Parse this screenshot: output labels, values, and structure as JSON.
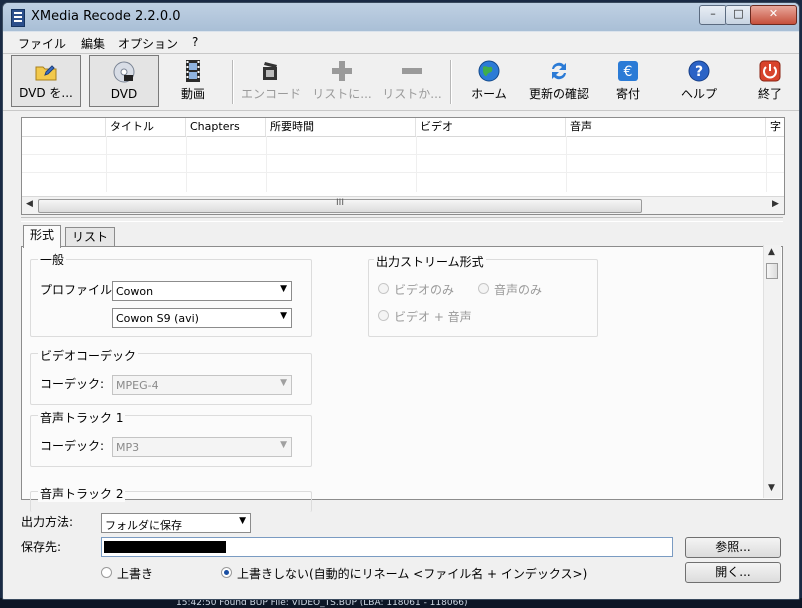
{
  "window": {
    "title": "XMedia Recode 2.2.0.0"
  },
  "menu": [
    "ファイル",
    "編集",
    "オプション",
    "?"
  ],
  "toolbar": {
    "open_dvd": "DVD を...",
    "dvd": "DVD",
    "video": "動画",
    "encode": "エンコード",
    "add_to_list": "リストに...",
    "remove_from_list": "リストか...",
    "home": "ホーム",
    "check_update": "更新の確認",
    "donate": "寄付",
    "help": "ヘルプ",
    "exit": "終了"
  },
  "list": {
    "columns": [
      "",
      "タイトル",
      "Chapters",
      "所要時間",
      "ビデオ",
      "音声",
      "字"
    ],
    "rows": [],
    "scroll_grip": "III"
  },
  "tabs": {
    "format": "形式",
    "list": "リスト"
  },
  "general": {
    "title": "一般",
    "profile_label": "プロファイル:",
    "profile_value": "Cowon",
    "device_value": "Cowon S9 (avi)"
  },
  "video_codec": {
    "title": "ビデオコーデック",
    "codec_label": "コーデック:",
    "codec_value": "MPEG-4"
  },
  "audio_track1": {
    "title": "音声トラック 1",
    "codec_label": "コーデック:",
    "codec_value": "MP3"
  },
  "audio_track2": {
    "title": "音声トラック 2"
  },
  "output_stream": {
    "title": "出力ストリーム形式",
    "video_only": "ビデオのみ",
    "audio_only": "音声のみ",
    "video_audio": "ビデオ + 音声"
  },
  "output": {
    "method_label": "出力方法:",
    "method_value": "フォルダに保存",
    "save_to_label": "保存先:",
    "browse": "参照...",
    "overwrite": "上書き",
    "no_overwrite": "上書きしない(自動的にリネーム <ファイル名 + インデックス>)",
    "open": "開く..."
  },
  "taskbar_text": "15:42:50 Found BUP File: VIDEO_TS.BUP   (LBA: 118061 - 118066)",
  "colors": {
    "titlebar": "#a9bfd6",
    "close_button": "#c6503c",
    "accent_blue": "#1a4fa3"
  },
  "icons": [
    "folder-dvd-icon",
    "dvd-disc-icon",
    "film-icon",
    "encode-icon",
    "plus-icon",
    "minus-icon",
    "globe-icon",
    "refresh-icon",
    "donate-icon",
    "help-icon",
    "power-icon"
  ]
}
